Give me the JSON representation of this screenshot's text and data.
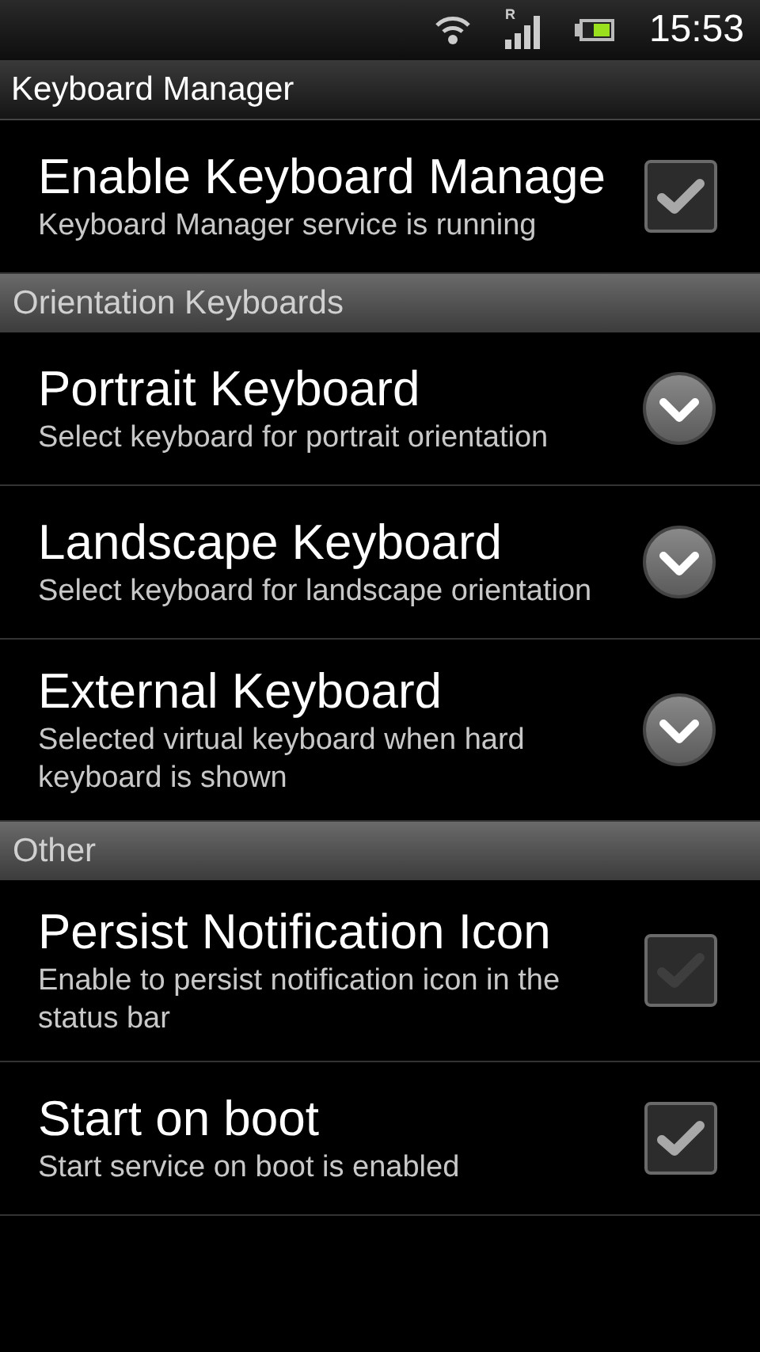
{
  "status_bar": {
    "time": "15:53",
    "roaming": "R"
  },
  "title_bar": {
    "title": "Keyboard Manager"
  },
  "sections": [
    {
      "items": [
        {
          "kind": "checkbox",
          "title": "Enable Keyboard Manage",
          "summary": "Keyboard Manager service is running",
          "checked": true
        }
      ]
    },
    {
      "header": "Orientation Keyboards",
      "items": [
        {
          "kind": "dropdown",
          "title": "Portrait Keyboard",
          "summary": "Select keyboard for portrait orientation"
        },
        {
          "kind": "dropdown",
          "title": "Landscape Keyboard",
          "summary": "Select keyboard for landscape orientation"
        },
        {
          "kind": "dropdown",
          "title": "External Keyboard",
          "summary": "Selected virtual keyboard when hard keyboard is shown"
        }
      ]
    },
    {
      "header": "Other",
      "items": [
        {
          "kind": "checkbox",
          "title": "Persist Notification Icon",
          "summary": "Enable to persist notification icon in the status bar",
          "checked": false
        },
        {
          "kind": "checkbox",
          "title": "Start on boot",
          "summary": "Start service on boot is enabled",
          "checked": true
        }
      ]
    }
  ]
}
